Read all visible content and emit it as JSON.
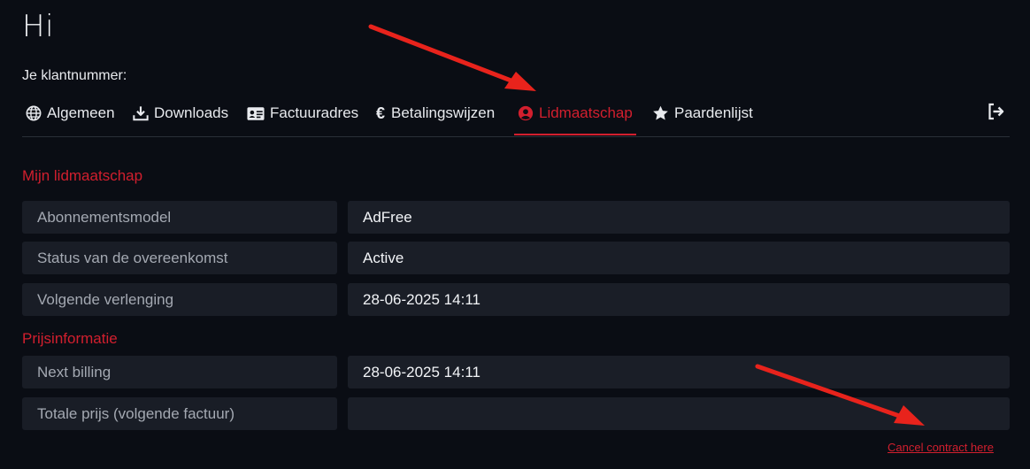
{
  "header": {
    "greeting": "Hi",
    "customer_label": "Je klantnummer:"
  },
  "tabs": [
    {
      "label": "Algemeen",
      "icon": "globe-icon",
      "active": false
    },
    {
      "label": "Downloads",
      "icon": "download-icon",
      "active": false
    },
    {
      "label": "Factuuradres",
      "icon": "id-card-icon",
      "active": false
    },
    {
      "label": "Betalingswijzen",
      "icon": "euro-icon",
      "active": false
    },
    {
      "label": "Lidmaatschap",
      "icon": "user-circle-icon",
      "active": true
    },
    {
      "label": "Paardenlijst",
      "icon": "star-icon",
      "active": false
    }
  ],
  "logout_icon": "logout-icon",
  "membership": {
    "title": "Mijn lidmaatschap",
    "rows": [
      {
        "label": "Abonnementsmodel",
        "value": "AdFree"
      },
      {
        "label": "Status van de overeenkomst",
        "value": "Active"
      },
      {
        "label": "Volgende verlenging",
        "value": "28-06-2025 14:11"
      }
    ]
  },
  "pricing": {
    "title": "Prijsinformatie",
    "rows": [
      {
        "label": "Next billing",
        "value": "28-06-2025 14:11"
      },
      {
        "label": "Totale prijs (volgende factuur)",
        "value": ""
      }
    ]
  },
  "cancel_link": "Cancel contract here",
  "colors": {
    "accent": "#d21f2e",
    "background": "#0a0d14",
    "field": "#191d26",
    "annotation_arrow": "#e8231c"
  }
}
